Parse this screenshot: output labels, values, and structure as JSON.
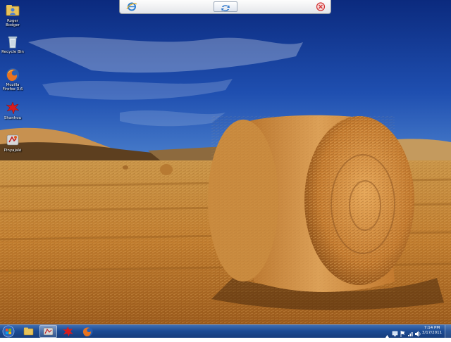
{
  "desktop": {
    "icons": [
      {
        "label": "Roger Bodger",
        "icon": "folder-user-icon"
      },
      {
        "label": "Recycle Bin",
        "icon": "recycle-bin-icon"
      },
      {
        "label": "Mozilla Firefox 3.6",
        "icon": "firefox-icon"
      },
      {
        "label": "Shanhou",
        "icon": "red-splat-icon"
      },
      {
        "label": "Pinyajalé",
        "icon": "app-shortcut-icon"
      }
    ]
  },
  "remote_toolbar": {
    "buttons": [
      "ie-icon",
      "refresh-icon",
      "close-icon"
    ]
  },
  "taskbar": {
    "start": "windows-start-orb-icon",
    "pinned": [
      "windows-explorer-icon",
      "open-app-icon",
      "red-splat-icon",
      "firefox-icon"
    ],
    "tray_icons": [
      "show-hidden-icons-arrow",
      "network-icon",
      "action-center-flag-icon",
      "signal-icon",
      "volume-icon"
    ],
    "clock": {
      "time": "7:14 PM",
      "date": "3/17/2011"
    }
  },
  "colors": {
    "sky_top": "#0b2a7e",
    "sky_bottom": "#3b74c8",
    "field": "#c98a3a",
    "taskbar": "#1c4b94"
  }
}
